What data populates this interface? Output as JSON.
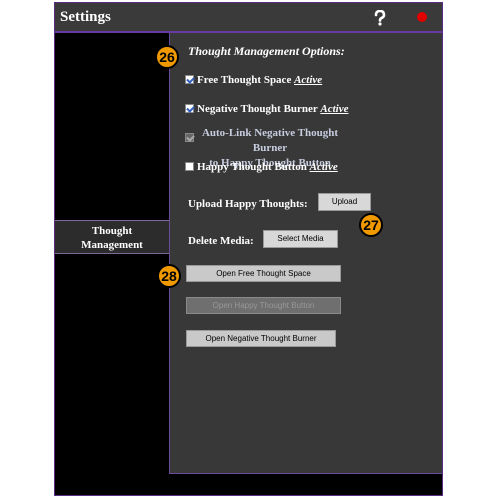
{
  "window": {
    "title": "Settings"
  },
  "sidebar": {
    "items": [
      {
        "label_line1": "Thought",
        "label_line2": "Management"
      }
    ]
  },
  "panel": {
    "heading": "Thought Management Options:",
    "options": [
      {
        "label": "Free Thought Space",
        "status": "Active",
        "checked": true
      },
      {
        "label": "Negative Thought Burner",
        "status": "Active",
        "checked": true
      },
      {
        "label_line1": "Auto-Link Negative Thought Burner",
        "label_line2": "to Happy Thought Button",
        "checked": true,
        "disabled": true
      },
      {
        "label": "Happy Thought Button",
        "status": "Active",
        "checked": false
      }
    ],
    "upload": {
      "label": "Upload Happy Thoughts:",
      "button": "Upload"
    },
    "delete": {
      "label": "Delete Media:",
      "button": "Select Media"
    },
    "buttons": {
      "open_free": "Open Free Thought Space",
      "open_happy": "Open Happy Thought Button",
      "open_negative": "Open Negative Thought Burner"
    }
  },
  "annotations": [
    "26",
    "27",
    "28"
  ],
  "colors": {
    "badge": "#f19a00",
    "accent": "#6a3aa0",
    "close": "#e00000"
  }
}
